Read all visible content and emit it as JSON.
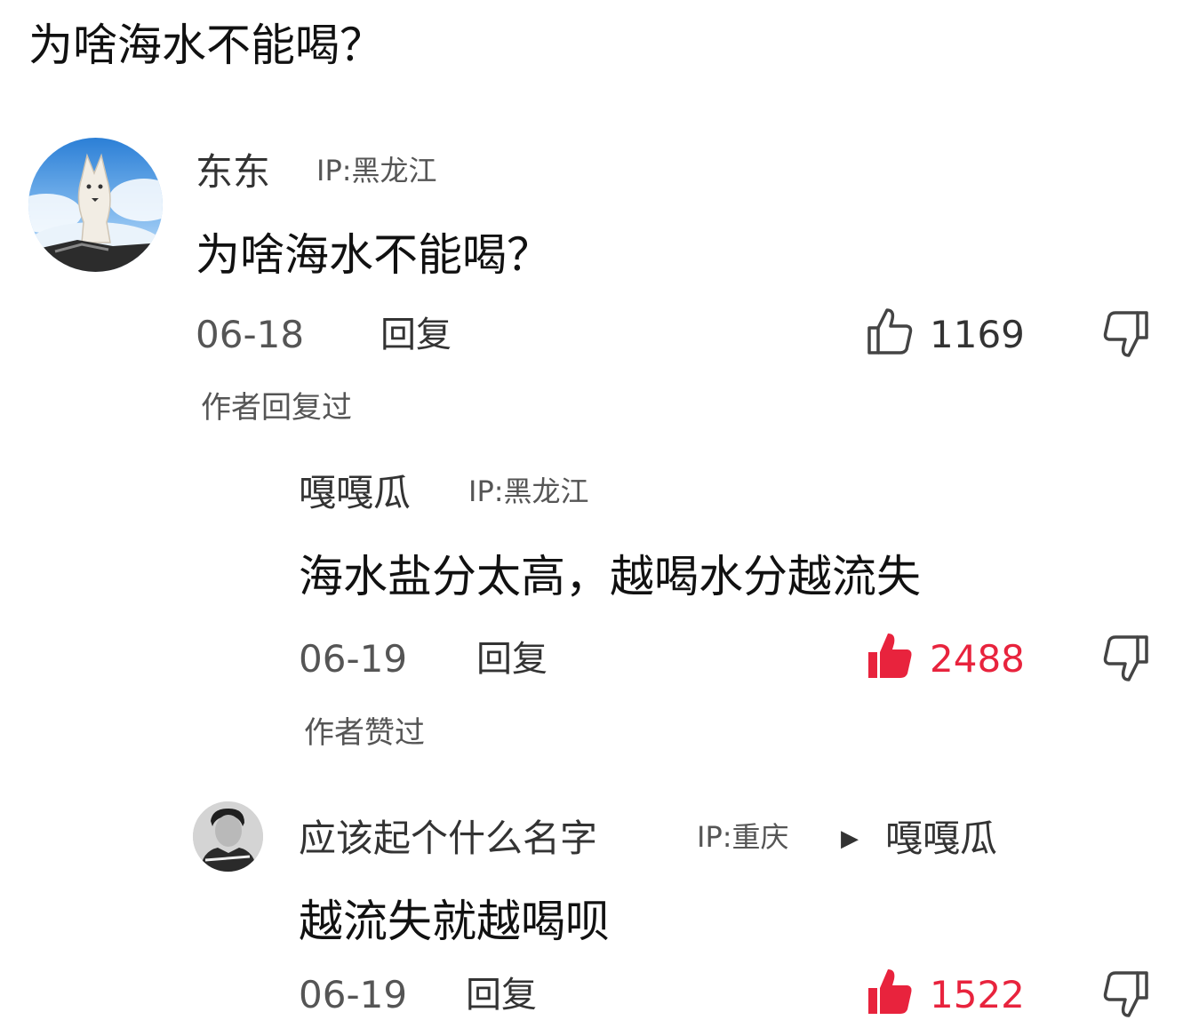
{
  "page": {
    "title": "为啥海水不能喝？"
  },
  "colors": {
    "liked": "#e8233d",
    "text": "#111111",
    "muted": "#555555"
  },
  "comments": [
    {
      "user": "东东",
      "ip": "IP:黑龙江",
      "content": "为啥海水不能喝？",
      "date": "06-18",
      "reply_label": "回复",
      "likes": "1169",
      "liked": false,
      "note": "作者回复过",
      "avatar_icon": "wolf-avatar"
    },
    {
      "user": "嘎嘎瓜",
      "ip": "IP:黑龙江",
      "content": "海水盐分太高，越喝水分越流失",
      "date": "06-19",
      "reply_label": "回复",
      "likes": "2488",
      "liked": true,
      "note": "作者赞过"
    },
    {
      "user": "应该起个什么名字",
      "ip": "IP:重庆",
      "reply_to": "嘎嘎瓜",
      "content": "越流失就越喝呗",
      "date": "06-19",
      "reply_label": "回复",
      "likes": "1522",
      "liked": true,
      "avatar_icon": "person-avatar"
    }
  ],
  "icons": {
    "like": "thumbs-up-icon",
    "dislike": "thumbs-down-icon",
    "reply_arrow": "play-arrow-icon"
  }
}
